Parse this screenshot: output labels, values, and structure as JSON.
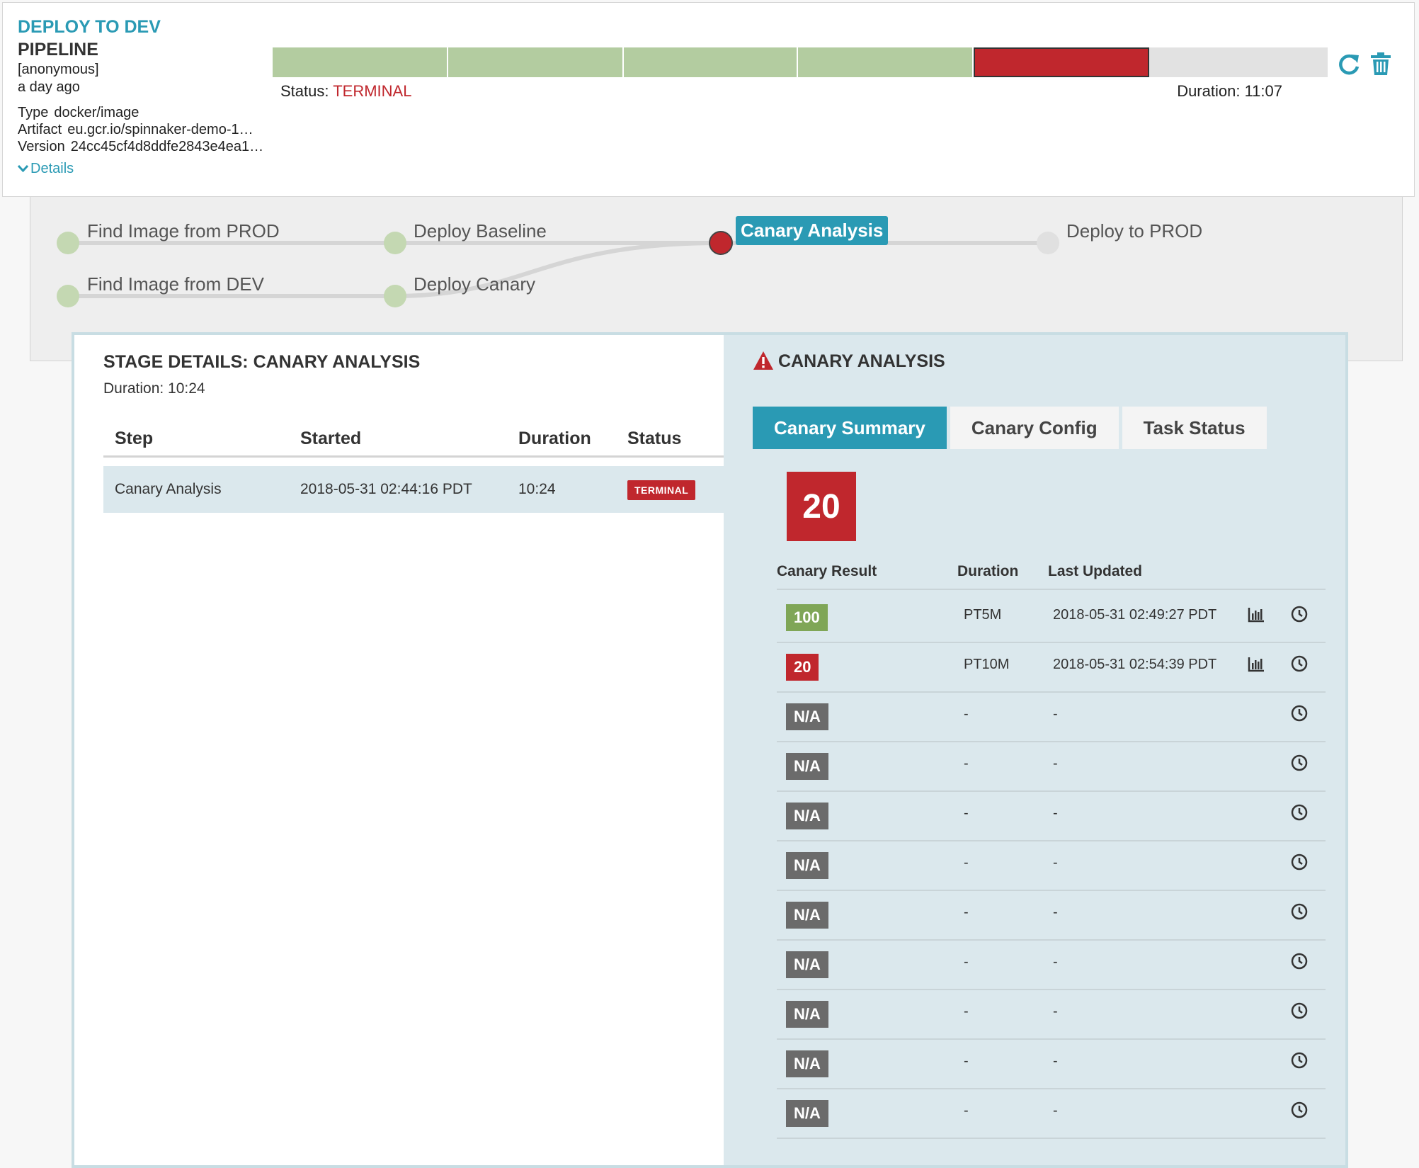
{
  "execution": {
    "title": "DEPLOY TO DEV",
    "subtitle": "PIPELINE",
    "trigger": "[anonymous]",
    "when": "a day ago",
    "meta": [
      {
        "key": "Type",
        "value": "docker/image"
      },
      {
        "key": "Artifact",
        "value": "eu.gcr.io/spinnaker-demo-1…"
      },
      {
        "key": "Version",
        "value": "24cc45cf4d8ddfe2843e4ea1…"
      }
    ],
    "details_label": "Details",
    "status_label": "Status:",
    "status": "TERMINAL",
    "duration": "Duration: 11:07",
    "progress_segments": [
      "succeeded",
      "succeeded",
      "succeeded",
      "succeeded",
      "terminal",
      "not_started"
    ],
    "actions": [
      "refresh-icon",
      "trash-icon"
    ]
  },
  "graph": {
    "nodes": [
      {
        "label": "Find Image from PROD",
        "status": "succeeded"
      },
      {
        "label": "Find Image from DEV",
        "status": "succeeded"
      },
      {
        "label": "Deploy Baseline",
        "status": "succeeded"
      },
      {
        "label": "Deploy Canary",
        "status": "succeeded"
      },
      {
        "label": "Canary Analysis",
        "status": "terminal",
        "active": true
      },
      {
        "label": "Deploy to PROD",
        "status": "not_started"
      }
    ]
  },
  "stage": {
    "title": "STAGE DETAILS: CANARY ANALYSIS",
    "duration": "Duration: 10:24",
    "columns": [
      "Step",
      "Started",
      "Duration",
      "Status"
    ],
    "steps": [
      {
        "name": "Canary Analysis",
        "started": "2018-05-31 02:44:16 PDT",
        "duration": "10:24",
        "status": "TERMINAL"
      }
    ]
  },
  "canary": {
    "heading": "CANARY ANALYSIS",
    "heading_icon": "warning-icon",
    "tabs": [
      "Canary Summary",
      "Canary Config",
      "Task Status"
    ],
    "active_tab": "Canary Summary",
    "overall_score": "20",
    "columns": [
      "Canary Result",
      "Duration",
      "Last Updated"
    ],
    "runs": [
      {
        "result": "100",
        "kind": "pass",
        "duration": "PT5M",
        "updated": "2018-05-31 02:49:27 PDT",
        "report": true
      },
      {
        "result": "20",
        "kind": "fail",
        "duration": "PT10M",
        "updated": "2018-05-31 02:54:39 PDT",
        "report": true
      },
      {
        "result": "N/A",
        "kind": "na",
        "duration": "-",
        "updated": "-",
        "report": false
      },
      {
        "result": "N/A",
        "kind": "na",
        "duration": "-",
        "updated": "-",
        "report": false
      },
      {
        "result": "N/A",
        "kind": "na",
        "duration": "-",
        "updated": "-",
        "report": false
      },
      {
        "result": "N/A",
        "kind": "na",
        "duration": "-",
        "updated": "-",
        "report": false
      },
      {
        "result": "N/A",
        "kind": "na",
        "duration": "-",
        "updated": "-",
        "report": false
      },
      {
        "result": "N/A",
        "kind": "na",
        "duration": "-",
        "updated": "-",
        "report": false
      },
      {
        "result": "N/A",
        "kind": "na",
        "duration": "-",
        "updated": "-",
        "report": false
      },
      {
        "result": "N/A",
        "kind": "na",
        "duration": "-",
        "updated": "-",
        "report": false
      },
      {
        "result": "N/A",
        "kind": "na",
        "duration": "-",
        "updated": "-",
        "report": false
      }
    ],
    "row_icons": [
      "bar-chart-icon",
      "clock-icon"
    ]
  },
  "colors": {
    "accent": "#2a9ab4",
    "succeeded": "#b3cca0",
    "terminal": "#c0272d",
    "pass": "#7fa657",
    "na": "#6b6b6b",
    "pane_bg": "#dbe8ed"
  }
}
